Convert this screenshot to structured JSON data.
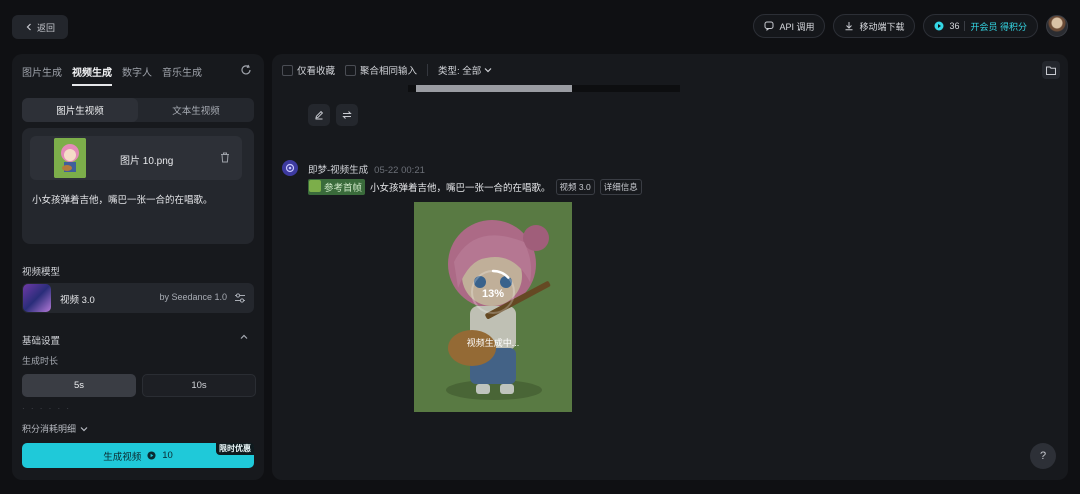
{
  "topbar": {
    "back_label": "返回",
    "api_label": "API 调用",
    "mobile_label": "移动端下载",
    "credits": "36",
    "vip_label": "开会员 得积分"
  },
  "left": {
    "tabs": [
      "图片生成",
      "视频生成",
      "数字人",
      "音乐生成"
    ],
    "active_tab": "视频生成",
    "subtabs": [
      "图片生视频",
      "文本生视频"
    ],
    "file_name": "图片 10.png",
    "prompt": "小女孩弹着吉他，嘴巴一张一合的在唱歌。",
    "model_section": "视频模型",
    "model_name": "视频 3.0",
    "model_by": "by Seedance 1.0",
    "basic_settings": "基础设置",
    "duration_label": "生成时长",
    "durations": [
      "5s",
      "10s"
    ],
    "dots": "· · · · · ·",
    "cost_label": "积分消耗明细",
    "generate_label": "生成视频",
    "generate_cost": "10",
    "promo": "限时优惠"
  },
  "right": {
    "filter_fav": "仅看收藏",
    "filter_merge": "聚合相同输入",
    "filter_type": "类型: 全部",
    "msg_title": "即梦-视频生成",
    "msg_time": "05-22  00:21",
    "ref_label": "参考首帧",
    "prompt": "小女孩弹着吉他，嘴巴一张一合的在唱歌。",
    "tag_model": "视频 3.0",
    "tag_detail": "详细信息",
    "progress_percent": 13,
    "progress_label": "13%",
    "status": "视频生成中..."
  },
  "help_label": "?",
  "colors": {
    "accent": "#1fc9d9",
    "vip": "#35d8e6",
    "panel": "#17191d"
  }
}
